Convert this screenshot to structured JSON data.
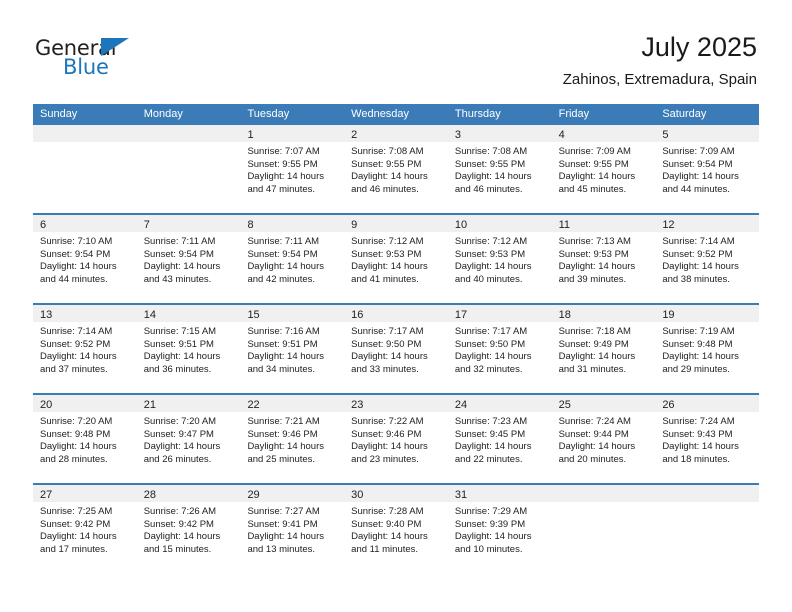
{
  "brand": {
    "name_top": "General",
    "name_bottom": "Blue",
    "color_blue": "#1b76bc",
    "color_dark": "#231f20",
    "triangle_icon": "triangle-icon"
  },
  "header": {
    "title": "July 2025",
    "subtitle": "Zahinos, Extremadura, Spain"
  },
  "theme": {
    "header_bar": "#3b7cb8",
    "band": "#f0f0f0",
    "text": "#222222"
  },
  "weekdays": [
    "Sunday",
    "Monday",
    "Tuesday",
    "Wednesday",
    "Thursday",
    "Friday",
    "Saturday"
  ],
  "labels": {
    "sunrise": "Sunrise:",
    "sunset": "Sunset:",
    "daylight": "Daylight:"
  },
  "weeks": [
    [
      {
        "day": ""
      },
      {
        "day": ""
      },
      {
        "day": "1",
        "sunrise": "Sunrise: 7:07 AM",
        "sunset": "Sunset: 9:55 PM",
        "daylight1": "Daylight: 14 hours",
        "daylight2": "and 47 minutes."
      },
      {
        "day": "2",
        "sunrise": "Sunrise: 7:08 AM",
        "sunset": "Sunset: 9:55 PM",
        "daylight1": "Daylight: 14 hours",
        "daylight2": "and 46 minutes."
      },
      {
        "day": "3",
        "sunrise": "Sunrise: 7:08 AM",
        "sunset": "Sunset: 9:55 PM",
        "daylight1": "Daylight: 14 hours",
        "daylight2": "and 46 minutes."
      },
      {
        "day": "4",
        "sunrise": "Sunrise: 7:09 AM",
        "sunset": "Sunset: 9:55 PM",
        "daylight1": "Daylight: 14 hours",
        "daylight2": "and 45 minutes."
      },
      {
        "day": "5",
        "sunrise": "Sunrise: 7:09 AM",
        "sunset": "Sunset: 9:54 PM",
        "daylight1": "Daylight: 14 hours",
        "daylight2": "and 44 minutes."
      }
    ],
    [
      {
        "day": "6",
        "sunrise": "Sunrise: 7:10 AM",
        "sunset": "Sunset: 9:54 PM",
        "daylight1": "Daylight: 14 hours",
        "daylight2": "and 44 minutes."
      },
      {
        "day": "7",
        "sunrise": "Sunrise: 7:11 AM",
        "sunset": "Sunset: 9:54 PM",
        "daylight1": "Daylight: 14 hours",
        "daylight2": "and 43 minutes."
      },
      {
        "day": "8",
        "sunrise": "Sunrise: 7:11 AM",
        "sunset": "Sunset: 9:54 PM",
        "daylight1": "Daylight: 14 hours",
        "daylight2": "and 42 minutes."
      },
      {
        "day": "9",
        "sunrise": "Sunrise: 7:12 AM",
        "sunset": "Sunset: 9:53 PM",
        "daylight1": "Daylight: 14 hours",
        "daylight2": "and 41 minutes."
      },
      {
        "day": "10",
        "sunrise": "Sunrise: 7:12 AM",
        "sunset": "Sunset: 9:53 PM",
        "daylight1": "Daylight: 14 hours",
        "daylight2": "and 40 minutes."
      },
      {
        "day": "11",
        "sunrise": "Sunrise: 7:13 AM",
        "sunset": "Sunset: 9:53 PM",
        "daylight1": "Daylight: 14 hours",
        "daylight2": "and 39 minutes."
      },
      {
        "day": "12",
        "sunrise": "Sunrise: 7:14 AM",
        "sunset": "Sunset: 9:52 PM",
        "daylight1": "Daylight: 14 hours",
        "daylight2": "and 38 minutes."
      }
    ],
    [
      {
        "day": "13",
        "sunrise": "Sunrise: 7:14 AM",
        "sunset": "Sunset: 9:52 PM",
        "daylight1": "Daylight: 14 hours",
        "daylight2": "and 37 minutes."
      },
      {
        "day": "14",
        "sunrise": "Sunrise: 7:15 AM",
        "sunset": "Sunset: 9:51 PM",
        "daylight1": "Daylight: 14 hours",
        "daylight2": "and 36 minutes."
      },
      {
        "day": "15",
        "sunrise": "Sunrise: 7:16 AM",
        "sunset": "Sunset: 9:51 PM",
        "daylight1": "Daylight: 14 hours",
        "daylight2": "and 34 minutes."
      },
      {
        "day": "16",
        "sunrise": "Sunrise: 7:17 AM",
        "sunset": "Sunset: 9:50 PM",
        "daylight1": "Daylight: 14 hours",
        "daylight2": "and 33 minutes."
      },
      {
        "day": "17",
        "sunrise": "Sunrise: 7:17 AM",
        "sunset": "Sunset: 9:50 PM",
        "daylight1": "Daylight: 14 hours",
        "daylight2": "and 32 minutes."
      },
      {
        "day": "18",
        "sunrise": "Sunrise: 7:18 AM",
        "sunset": "Sunset: 9:49 PM",
        "daylight1": "Daylight: 14 hours",
        "daylight2": "and 31 minutes."
      },
      {
        "day": "19",
        "sunrise": "Sunrise: 7:19 AM",
        "sunset": "Sunset: 9:48 PM",
        "daylight1": "Daylight: 14 hours",
        "daylight2": "and 29 minutes."
      }
    ],
    [
      {
        "day": "20",
        "sunrise": "Sunrise: 7:20 AM",
        "sunset": "Sunset: 9:48 PM",
        "daylight1": "Daylight: 14 hours",
        "daylight2": "and 28 minutes."
      },
      {
        "day": "21",
        "sunrise": "Sunrise: 7:20 AM",
        "sunset": "Sunset: 9:47 PM",
        "daylight1": "Daylight: 14 hours",
        "daylight2": "and 26 minutes."
      },
      {
        "day": "22",
        "sunrise": "Sunrise: 7:21 AM",
        "sunset": "Sunset: 9:46 PM",
        "daylight1": "Daylight: 14 hours",
        "daylight2": "and 25 minutes."
      },
      {
        "day": "23",
        "sunrise": "Sunrise: 7:22 AM",
        "sunset": "Sunset: 9:46 PM",
        "daylight1": "Daylight: 14 hours",
        "daylight2": "and 23 minutes."
      },
      {
        "day": "24",
        "sunrise": "Sunrise: 7:23 AM",
        "sunset": "Sunset: 9:45 PM",
        "daylight1": "Daylight: 14 hours",
        "daylight2": "and 22 minutes."
      },
      {
        "day": "25",
        "sunrise": "Sunrise: 7:24 AM",
        "sunset": "Sunset: 9:44 PM",
        "daylight1": "Daylight: 14 hours",
        "daylight2": "and 20 minutes."
      },
      {
        "day": "26",
        "sunrise": "Sunrise: 7:24 AM",
        "sunset": "Sunset: 9:43 PM",
        "daylight1": "Daylight: 14 hours",
        "daylight2": "and 18 minutes."
      }
    ],
    [
      {
        "day": "27",
        "sunrise": "Sunrise: 7:25 AM",
        "sunset": "Sunset: 9:42 PM",
        "daylight1": "Daylight: 14 hours",
        "daylight2": "and 17 minutes."
      },
      {
        "day": "28",
        "sunrise": "Sunrise: 7:26 AM",
        "sunset": "Sunset: 9:42 PM",
        "daylight1": "Daylight: 14 hours",
        "daylight2": "and 15 minutes."
      },
      {
        "day": "29",
        "sunrise": "Sunrise: 7:27 AM",
        "sunset": "Sunset: 9:41 PM",
        "daylight1": "Daylight: 14 hours",
        "daylight2": "and 13 minutes."
      },
      {
        "day": "30",
        "sunrise": "Sunrise: 7:28 AM",
        "sunset": "Sunset: 9:40 PM",
        "daylight1": "Daylight: 14 hours",
        "daylight2": "and 11 minutes."
      },
      {
        "day": "31",
        "sunrise": "Sunrise: 7:29 AM",
        "sunset": "Sunset: 9:39 PM",
        "daylight1": "Daylight: 14 hours",
        "daylight2": "and 10 minutes."
      },
      {
        "day": ""
      },
      {
        "day": ""
      }
    ]
  ]
}
